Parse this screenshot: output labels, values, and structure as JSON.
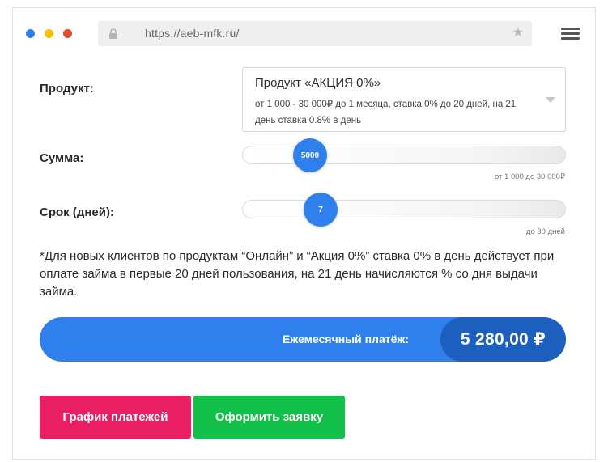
{
  "browser": {
    "url": "https://aeb-mfk.ru/",
    "colors": {
      "dot_blue": "#2f80ed",
      "dot_yellow": "#f5c400",
      "dot_red": "#e8492f"
    }
  },
  "calculator": {
    "product": {
      "label": "Продукт:",
      "selected_title": "Продукт «АКЦИЯ 0%»",
      "selected_desc": "от 1 000 - 30 000₽ до 1 месяца, ставка 0% до 20 дней, на 21 день ставка 0.8% в день"
    },
    "amount": {
      "label": "Сумма:",
      "value": "5000",
      "hint": "от 1 000 до 30 000₽",
      "min": 1000,
      "max": 30000
    },
    "term": {
      "label": "Срок (дней):",
      "value": "7",
      "hint": "до 30 дней",
      "min": 1,
      "max": 30
    },
    "note": "*Для новых клиентов по продуктам “Онлайн” и “Акция 0%” ставка 0% в день действует при оплате займа в первые 20 дней пользования, на 21 день начисляются % со дня выдачи займа.",
    "payment": {
      "label": "Ежемесячный платёж:",
      "value": "5 280,00 ₽"
    },
    "buttons": {
      "schedule": "График платежей",
      "apply": "Оформить заявку"
    },
    "colors": {
      "accent": "#2f80ed",
      "schedule": "#ea1e63",
      "apply": "#13c14a"
    }
  }
}
